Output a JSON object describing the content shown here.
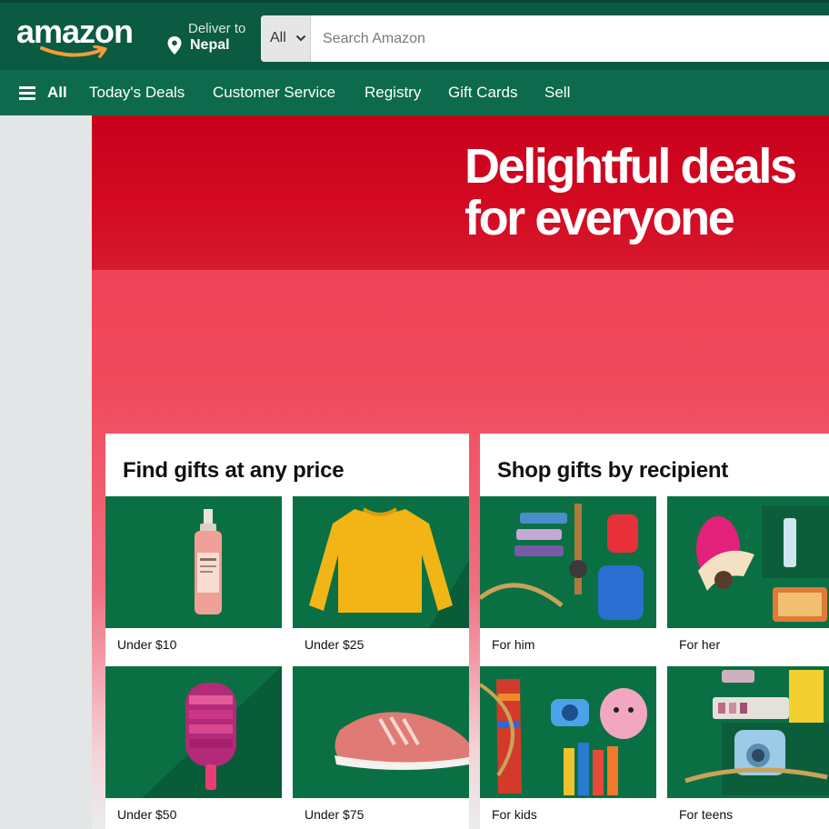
{
  "header": {
    "logo_text": "amazon",
    "deliver_to_label": "Deliver to",
    "deliver_to_location": "Nepal",
    "search": {
      "category": "All",
      "placeholder": "Search Amazon"
    }
  },
  "nav": {
    "all_label": "All",
    "items": [
      "Today's Deals",
      "Customer Service",
      "Registry",
      "Gift Cards",
      "Sell"
    ]
  },
  "hero": {
    "headline_line1": "Delightful deals",
    "headline_line2": "for everyone"
  },
  "cards": [
    {
      "title": "Find gifts at any price",
      "tiles": [
        "Under $10",
        "Under $25",
        "Under $50",
        "Under $75"
      ]
    },
    {
      "title": "Shop gifts by recipient",
      "tiles": [
        "For him",
        "For her",
        "For kids",
        "For teens"
      ]
    }
  ],
  "colors": {
    "header_dark_green": "#0b5a42",
    "nav_green": "#0e6a4c",
    "hero_red": "#d40a22",
    "tile_green": "#0a7043"
  }
}
